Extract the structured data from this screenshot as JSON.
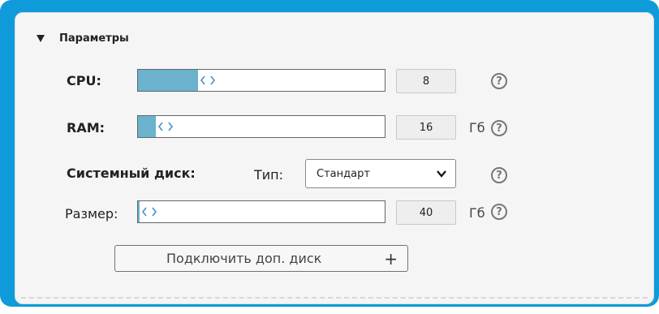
{
  "section": {
    "title": "Параметры"
  },
  "cpu": {
    "label": "CPU:",
    "value": "8",
    "slider_fraction": 0.25
  },
  "ram": {
    "label": "RAM:",
    "value": "16",
    "unit": "Гб",
    "slider_fraction": 0.08
  },
  "disk": {
    "label": "Системный диск:",
    "type_label": "Тип:",
    "type_value": "Стандарт",
    "size_label": "Размер:",
    "size_value": "40",
    "unit": "Гб",
    "slider_fraction": 0.0
  },
  "add_disk_button": {
    "label": "Подключить доп. диск",
    "icon": "+"
  },
  "help_glyph": "?",
  "slider_handle_glyph": "‹›",
  "colors": {
    "frame": "#0f9bd9",
    "slider_fill": "#6cb2cc",
    "handle": "#3f95c9"
  }
}
